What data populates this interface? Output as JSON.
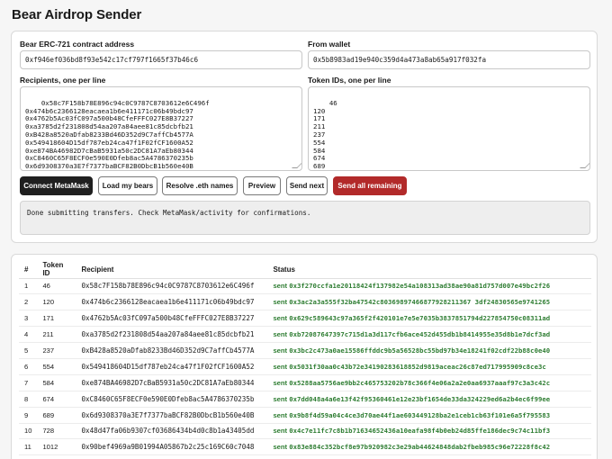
{
  "title": "Bear Airdrop Sender",
  "form": {
    "contract_label": "Bear ERC-721 contract address",
    "contract_value": "0xf946ef036bd8f93e542c17cf797f1665f37b46c6",
    "wallet_label": "From wallet",
    "wallet_value": "0x5b8983ad19e940c359d4a473a8ab65a917f032fa",
    "recipients_label": "Recipients, one per line",
    "recipients_text": "0x58c7F158b78E896c94c0C9787C8703612e6C496f\n0x474b6c2366128eacaea1b6e411171c06b49bdc97\n0x4762b5Ac03fC097a500b48CfeFFFC027E8B37227\n0xa3785d2f231808d54aa207a84aee81c85dcbfb21\n0xB428a8520aDfab8233Bd46D352d9C7affCb4577A\n0x549418604D15df787eb24ca47f1F02fCF1600A52\n0xe874BA46982D7cBaB5931a50c2DC81A7aEb80344\n0xC8460C65F8ECF0e590E0Dfeb8ac5A4786370235b\n0x6d9308370a3E7f7377baBCF82B0DbcB1b560e40B\n0x48d47fa06b9307cf03686434b4d0c8b1a43405dd\n0x90bef4969a9B01994A05867b2c25c169C60c7048",
    "token_label": "Token IDs, one per line",
    "token_text": "46\n120\n171\n211\n237\n554\n584\n674\n689\n728\n1012"
  },
  "buttons": {
    "connect": "Connect MetaMask",
    "load": "Load my bears",
    "resolve": "Resolve .eth names",
    "preview": "Preview",
    "send_next": "Send next",
    "send_all": "Send all remaining"
  },
  "log_text": "Done submitting transfers. Check MetaMask/activity for confirmations.",
  "table": {
    "headers": [
      "#",
      "Token ID",
      "Recipient",
      "Status"
    ],
    "rows": [
      {
        "n": "1",
        "token": "46",
        "recipient": "0x58c7F158b78E896c94c0C9787C8703612e6C496f",
        "state": "sent",
        "tx": "0x3f270ccfa1e20118424f137982e54a108313ad38ae90a81d757d007e49bc2f26"
      },
      {
        "n": "2",
        "token": "120",
        "recipient": "0x474b6c2366128eacaea1b6e411171c06b49bdc97",
        "state": "sent",
        "tx": "0x3ac2a3a555f32ba47542c80369897466877928211367 3df24830565e9741265"
      },
      {
        "n": "3",
        "token": "171",
        "recipient": "0x4762b5Ac03fC097a500b48CfeFFFC027E8B37227",
        "state": "sent",
        "tx": "0x629c589643c97a365f2f420101e7e5e7035b3837851794d227854750c08311ad"
      },
      {
        "n": "4",
        "token": "211",
        "recipient": "0xa3785d2f231808d54aa207a84aee81c85dcbfb21",
        "state": "sent",
        "tx": "0xb72087647397c715d1a3d117cfb6ace452d455db1b8414955e35d8b1e7dcf3ad"
      },
      {
        "n": "5",
        "token": "237",
        "recipient": "0xB428a8520aDfab8233Bd46D352d9C7affCb4577A",
        "state": "sent",
        "tx": "0x3bc2c473a0ae15586ffddc9b5a56528bc55bd97b34e18241f02cdf22b88c0e40"
      },
      {
        "n": "6",
        "token": "554",
        "recipient": "0x549418604D15df787eb24ca47f1F02fCF1600A52",
        "state": "sent",
        "tx": "0x5031f30aa0c43b72e34190283618852d9819aceac26c87ed717995909c8ce3c"
      },
      {
        "n": "7",
        "token": "584",
        "recipient": "0xe874BA46982D7cBaB5931a50c2DC81A7aEb80344",
        "state": "sent",
        "tx": "0x5288aa5756ae9bb2c465753202b78c366f4e06a2a2e0aa6937aaaf97c3a3c42c"
      },
      {
        "n": "8",
        "token": "674",
        "recipient": "0xC8460C65F8ECF0e590E0Dfeb8ac5A4786370235b",
        "state": "sent",
        "tx": "0x7dd048a4a6e13f42f95360461e12e23bf1654de33da324229ed6a2b4ec6f99ee"
      },
      {
        "n": "9",
        "token": "689",
        "recipient": "0x6d9308370a3E7f7377baBCF82B0DbcB1b560e40B",
        "state": "sent",
        "tx": "0x9b8f4d59a04c4ce3d70ae44f1ae603449128ba2e1ceb1cb63f101e6a5f795583"
      },
      {
        "n": "10",
        "token": "728",
        "recipient": "0x48d47fa06b9307cf03686434b4d0c8b1a43405dd",
        "state": "sent",
        "tx": "0x4c7e11fc7c8b1b71634652436a10eafa98f4b0eb24d85ffe186dec9c74c11bf3"
      },
      {
        "n": "11",
        "token": "1012",
        "recipient": "0x90bef4969a9B01994A05867b2c25c169C60c7048",
        "state": "sent",
        "tx": "0x83e884c352bcf8e97b920982c3e29ab44624848dab2fbeb985c96e72228f8c42"
      }
    ]
  }
}
